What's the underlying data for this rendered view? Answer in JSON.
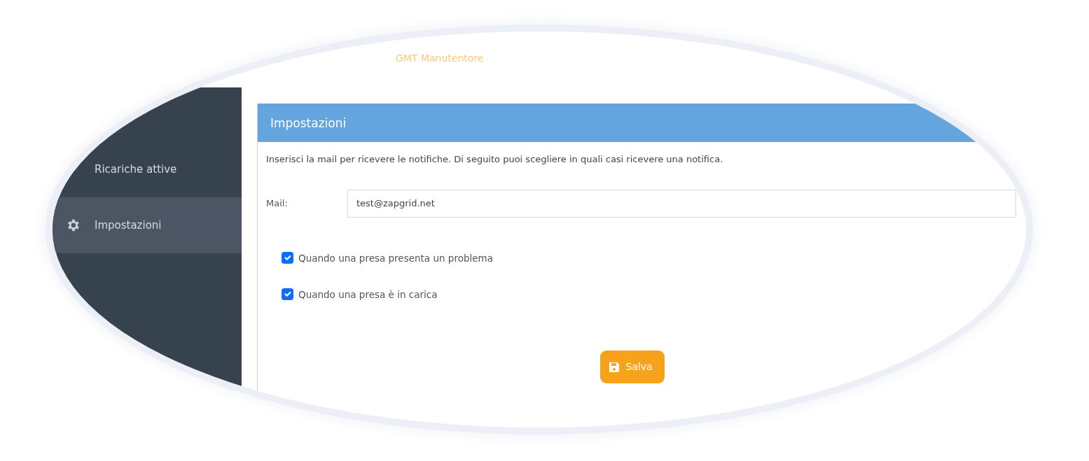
{
  "header": {
    "user_label": "GMT Manutentore"
  },
  "sidebar": {
    "items": [
      {
        "label": "Ricariche attive",
        "selected": false,
        "kind": "plain"
      },
      {
        "label": "Impostazioni",
        "selected": true,
        "kind": "iconed"
      }
    ]
  },
  "panel": {
    "title": "Impostazioni",
    "description": "Inserisci la mail per ricevere le notifiche. Di seguito puoi scegliere in quali casi ricevere una notifica.",
    "mail": {
      "label": "Mail:",
      "value": "test@zapgrid.net"
    },
    "options": [
      {
        "label": "Quando una presa presenta un problema",
        "checked": true
      },
      {
        "label": "Quando una presa è in carica",
        "checked": true
      }
    ],
    "save_button": "Salva"
  }
}
